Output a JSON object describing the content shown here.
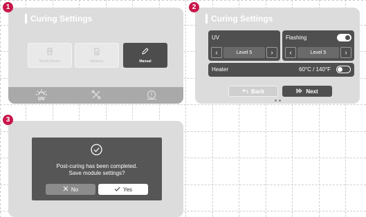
{
  "badges": [
    "1",
    "2",
    "3"
  ],
  "panel1": {
    "title": "Curing Settings",
    "tiles": [
      {
        "label": "Brand Resins",
        "icon": "resin-bottle-icon"
      },
      {
        "label": "Modules",
        "icon": "document-icon"
      },
      {
        "label": "Manual",
        "icon": "pencil-icon"
      }
    ],
    "bottom_nav": [
      {
        "label": "UV",
        "icon": "uv-light-icon"
      },
      {
        "label": "",
        "icon": "tools-icon"
      },
      {
        "label": "",
        "icon": "alert-icon"
      }
    ]
  },
  "panel2": {
    "title": "Curing Settings",
    "uv": {
      "label": "UV",
      "value": "Level 5"
    },
    "flashing": {
      "label": "Flashing",
      "value": "Level 5",
      "toggle": "on"
    },
    "heater": {
      "label": "Heater",
      "value": "60°C / 140°F",
      "toggle": "off"
    },
    "back_label": "Back",
    "next_label": "Next",
    "dec_symbol": "‹",
    "inc_symbol": "›"
  },
  "panel3": {
    "message_line1": "Post-curing has been completed.",
    "message_line2": "Save module settings?",
    "no_label": "No",
    "yes_label": "Yes"
  },
  "colors": {
    "badge": "#c8174a",
    "panel": "#dcdcdc",
    "card": "#4f4f4f",
    "bottom_bar": "#a9a9a9"
  }
}
